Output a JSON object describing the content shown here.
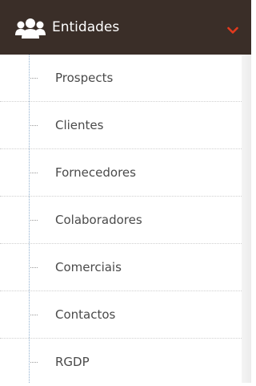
{
  "header": {
    "title": "Entidades",
    "icon": "users-group-icon",
    "chevron": "chevron-down-icon",
    "accent_color": "#e23a1e",
    "background": "#3a2e28"
  },
  "submenu": {
    "items": [
      {
        "label": "Prospects"
      },
      {
        "label": "Clientes"
      },
      {
        "label": "Fornecedores"
      },
      {
        "label": "Colaboradores"
      },
      {
        "label": "Comerciais"
      },
      {
        "label": "Contactos"
      },
      {
        "label": "RGDP"
      }
    ]
  }
}
